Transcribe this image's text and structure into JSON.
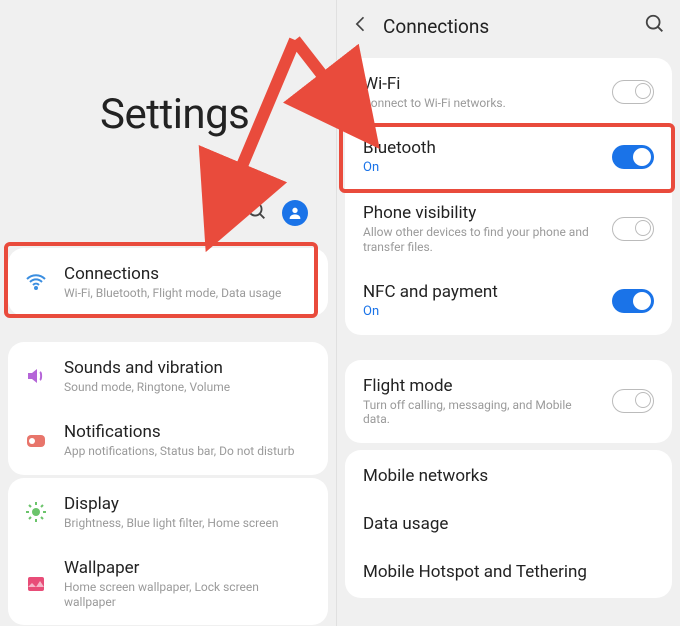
{
  "left": {
    "title": "Settings",
    "items": [
      {
        "title": "Connections",
        "subtitle": "Wi-Fi, Bluetooth, Flight mode, Data usage"
      },
      {
        "title": "Sounds and vibration",
        "subtitle": "Sound mode, Ringtone, Volume"
      },
      {
        "title": "Notifications",
        "subtitle": "App notifications, Status bar, Do not disturb"
      },
      {
        "title": "Display",
        "subtitle": "Brightness, Blue light filter, Home screen"
      },
      {
        "title": "Wallpaper",
        "subtitle": "Home screen wallpaper, Lock screen wallpaper"
      }
    ]
  },
  "right": {
    "title": "Connections",
    "items": [
      {
        "title": "Wi-Fi",
        "subtitle": "Connect to Wi-Fi networks.",
        "toggle": "outline"
      },
      {
        "title": "Bluetooth",
        "status": "On",
        "toggle": "on"
      },
      {
        "title": "Phone visibility",
        "subtitle": "Allow other devices to find your phone and transfer files.",
        "toggle": "outline"
      },
      {
        "title": "NFC and payment",
        "status": "On",
        "toggle": "on"
      },
      {
        "title": "Flight mode",
        "subtitle": "Turn off calling, messaging, and Mobile data.",
        "toggle": "outline"
      },
      {
        "title": "Mobile networks"
      },
      {
        "title": "Data usage"
      },
      {
        "title": "Mobile Hotspot and Tethering"
      }
    ]
  }
}
